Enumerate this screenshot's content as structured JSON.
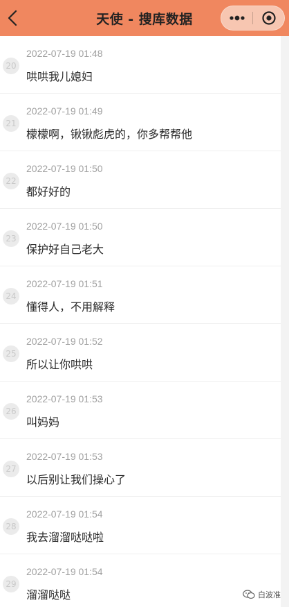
{
  "nav": {
    "title": "天使 - 搜库数据",
    "back_icon": "chevron-left-icon",
    "more_icon": "more-dots-icon",
    "close_icon": "target-close-icon",
    "bar_color": "#f0875f"
  },
  "messages": [
    {
      "num": "20",
      "time": "2022-07-19 01:48",
      "text": "哄哄我儿媳妇"
    },
    {
      "num": "21",
      "time": "2022-07-19 01:49",
      "text": "檬檬啊，锹锹彪虎的，你多帮帮他"
    },
    {
      "num": "22",
      "time": "2022-07-19 01:50",
      "text": "都好好的"
    },
    {
      "num": "23",
      "time": "2022-07-19 01:50",
      "text": "保护好自己老大"
    },
    {
      "num": "24",
      "time": "2022-07-19 01:51",
      "text": "懂得人，不用解释"
    },
    {
      "num": "25",
      "time": "2022-07-19 01:52",
      "text": "所以让你哄哄"
    },
    {
      "num": "26",
      "time": "2022-07-19 01:53",
      "text": "叫妈妈"
    },
    {
      "num": "27",
      "time": "2022-07-19 01:53",
      "text": "以后别让我们操心了"
    },
    {
      "num": "28",
      "time": "2022-07-19 01:54",
      "text": "我去溜溜哒哒啦"
    },
    {
      "num": "29",
      "time": "2022-07-19 01:54",
      "text": "溜溜哒哒"
    }
  ],
  "watermark": {
    "text": "白波准",
    "icon": "wechat-icon"
  }
}
